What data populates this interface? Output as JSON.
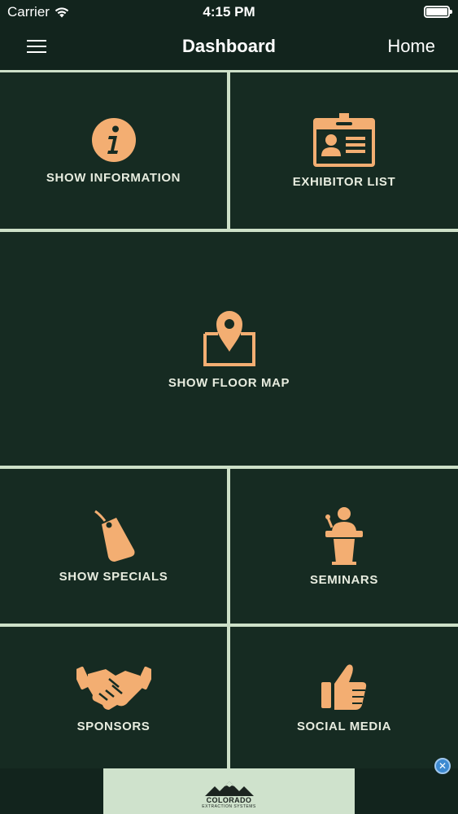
{
  "status_bar": {
    "carrier": "Carrier",
    "time": "4:15 PM"
  },
  "nav": {
    "title": "Dashboard",
    "home_label": "Home"
  },
  "tiles": [
    {
      "label": "SHOW INFORMATION",
      "icon": "info-icon"
    },
    {
      "label": "EXHIBITOR LIST",
      "icon": "id-badge-icon"
    },
    {
      "label": "SHOW FLOOR MAP",
      "icon": "map-pin-icon"
    },
    {
      "label": "SHOW SPECIALS",
      "icon": "price-tag-icon"
    },
    {
      "label": "SEMINARS",
      "icon": "speaker-podium-icon"
    },
    {
      "label": "SPONSORS",
      "icon": "handshake-icon"
    },
    {
      "label": "SOCIAL MEDIA",
      "icon": "thumbs-up-icon"
    }
  ],
  "ad": {
    "logo_text": "COLORADO",
    "logo_subtext": "EXTRACTION SYSTEMS",
    "close_symbol": "✕"
  },
  "colors": {
    "background": "#12241d",
    "tile": "#162b22",
    "grid_line": "#cde0c8",
    "accent": "#f3ae72"
  }
}
